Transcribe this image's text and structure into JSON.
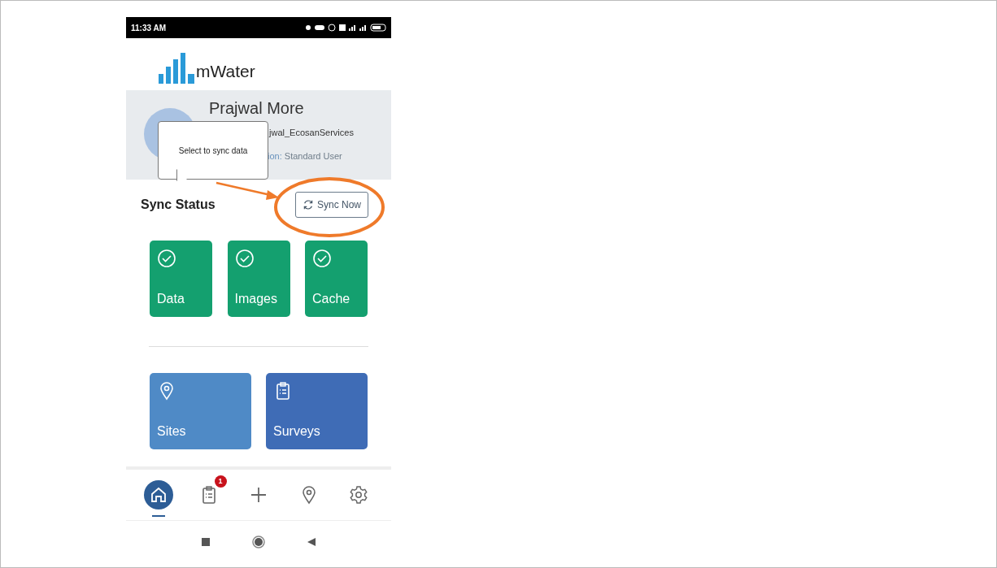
{
  "status_bar": {
    "time": "11:33 AM"
  },
  "logo": {
    "text": "mWater"
  },
  "profile": {
    "name": "Prajwal More",
    "username": "jwal_EcosanServices",
    "role_label": "ion:",
    "role": "Standard User"
  },
  "tooltip": {
    "text": "Select to sync data"
  },
  "sync": {
    "title": "Sync Status",
    "button": "Sync Now"
  },
  "sync_tiles": [
    {
      "label": "Data"
    },
    {
      "label": "Images"
    },
    {
      "label": "Cache"
    }
  ],
  "tiles": [
    {
      "label": "Sites",
      "kind": "pin",
      "color": "#4f8ac6"
    },
    {
      "label": "Surveys",
      "kind": "clipboard",
      "color": "#3f6cb6"
    }
  ],
  "nav": [
    {
      "kind": "home",
      "selected": true
    },
    {
      "kind": "clipboard",
      "selected": false,
      "badge": "1"
    },
    {
      "kind": "plus",
      "selected": false
    },
    {
      "kind": "pin",
      "selected": false
    },
    {
      "kind": "gear",
      "selected": false
    }
  ]
}
